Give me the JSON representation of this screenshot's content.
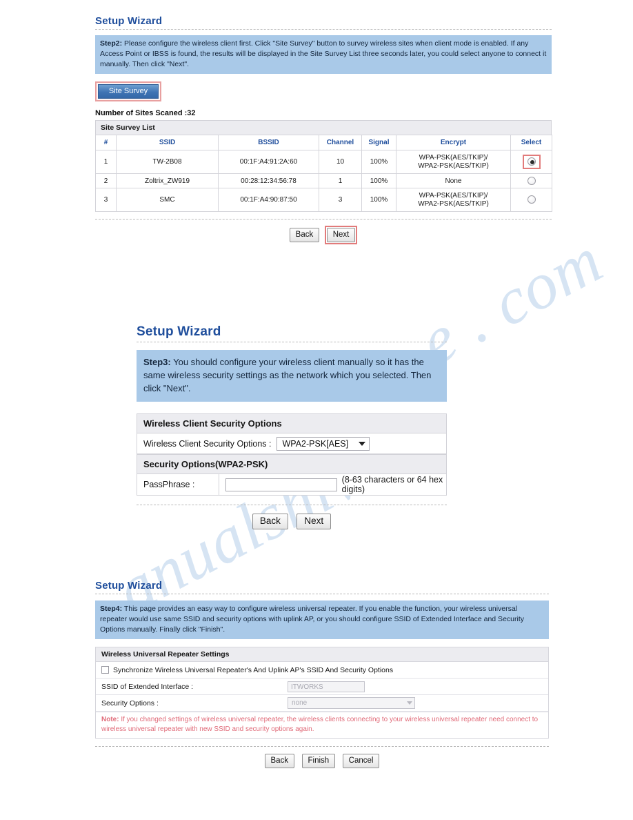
{
  "watermark": {
    "line1": "anualshive.",
    "line2": "e . com"
  },
  "step2": {
    "title": "Setup Wizard",
    "banner_label": "Step2:",
    "banner_text": " Please configure the wireless client first. Click \"Site Survey\" button to survey wireless sites when client mode is enabled. If any Access Point or IBSS is found, the results will be displayed in the Site Survey List three seconds later, you could select anyone to connect it manually. Then click \"Next\".",
    "site_survey_button": "Site Survey",
    "scan_count_text": "Number of Sites Scaned :32",
    "table_caption": "Site Survey List",
    "columns": [
      "#",
      "SSID",
      "BSSID",
      "Channel",
      "Signal",
      "Encrypt",
      "Select"
    ],
    "rows": [
      {
        "index": "1",
        "ssid": "TW-2B08",
        "bssid": "00:1F:A4:91:2A:60",
        "channel": "10",
        "signal": "100%",
        "encrypt_line1": "WPA-PSK(AES/TKIP)/",
        "encrypt_line2": "WPA2-PSK(AES/TKIP)",
        "selected": true
      },
      {
        "index": "2",
        "ssid": "Zoltrix_ZW919",
        "bssid": "00:28:12:34:56:78",
        "channel": "1",
        "signal": "100%",
        "encrypt_line1": "None",
        "encrypt_line2": "",
        "selected": false
      },
      {
        "index": "3",
        "ssid": "SMC",
        "bssid": "00:1F:A4:90:87:50",
        "channel": "3",
        "signal": "100%",
        "encrypt_line1": "WPA-PSK(AES/TKIP)/",
        "encrypt_line2": "WPA2-PSK(AES/TKIP)",
        "selected": false
      }
    ],
    "back_label": "Back",
    "next_label": "Next"
  },
  "step3": {
    "title": "Setup Wizard",
    "banner_label": "Step3:",
    "banner_text": " You should configure your wireless client manually so it has the same wireless security settings as the network which you selected. Then click \"Next\".",
    "section1_head": "Wireless Client Security Options",
    "field1_label": "Wireless Client Security Options :",
    "field1_value": "WPA2-PSK[AES]",
    "section2_head": "Security Options(WPA2-PSK)",
    "field2_label": "PassPhrase :",
    "field2_value": "",
    "field2_hint": "(8-63 characters or 64 hex digits)",
    "back_label": "Back",
    "next_label": "Next"
  },
  "step4": {
    "title": "Setup Wizard",
    "banner_label": "Step4:",
    "banner_text": " This page provides an easy way to configure wireless universal repeater. If you enable the function, your wireless universal repeater would use same SSID and security options with uplink AP, or you should configure SSID of Extended Interface and Security Options manually. Finally click \"Finish\".",
    "section_head": "Wireless Universal Repeater Settings",
    "checkbox_label": "Synchronize Wireless Universal Repeater's And Uplink AP's SSID And Security Options",
    "checkbox_checked": false,
    "ssid_label": "SSID of Extended Interface :",
    "ssid_value": "ITWORKS",
    "security_label": "Security Options :",
    "security_value": "none",
    "note_label": "Note:",
    "note_text": " If you changed settings of wireless universal repeater, the wireless clients connecting to your wireless universal repeater need connect to wireless universal repeater with new SSID and security options again.",
    "back_label": "Back",
    "finish_label": "Finish",
    "cancel_label": "Cancel"
  }
}
